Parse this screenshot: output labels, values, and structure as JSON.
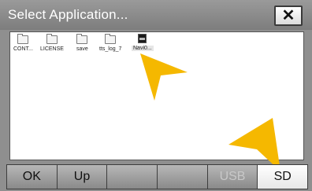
{
  "title": "Select Application...",
  "close_label": "✕",
  "files": [
    {
      "name": "CONT...",
      "icon": "folder-icon"
    },
    {
      "name": "LICENSE",
      "icon": "folder-icon"
    },
    {
      "name": "save",
      "icon": "folder-icon"
    },
    {
      "name": "tts_log_7",
      "icon": "folder-icon"
    },
    {
      "name": "Navi0...",
      "icon": "app-file-icon",
      "selected": true
    }
  ],
  "toolbar": {
    "ok": "OK",
    "up": "Up",
    "blank1": "",
    "blank2": "",
    "usb": "USB",
    "sd": "SD"
  },
  "colors": {
    "accent_arrow": "#f5b800",
    "title_bar": "#8a8a8a",
    "active_button": "#ffffff"
  }
}
